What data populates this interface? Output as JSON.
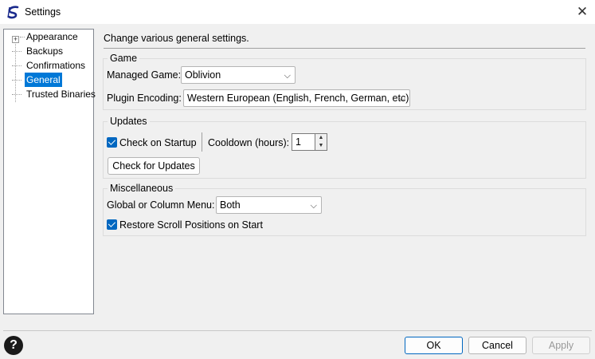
{
  "window": {
    "title": "Settings"
  },
  "tree": {
    "items": [
      {
        "label": "Appearance"
      },
      {
        "label": "Backups"
      },
      {
        "label": "Confirmations"
      },
      {
        "label": "General"
      },
      {
        "label": "Trusted Binaries"
      }
    ]
  },
  "general": {
    "description": "Change various general settings.",
    "game": {
      "title": "Game",
      "managed_game_label": "Managed Game:",
      "managed_game_value": "Oblivion",
      "plugin_encoding_label": "Plugin Encoding:",
      "plugin_encoding_value": "Western European (English, French, German, etc)"
    },
    "updates": {
      "title": "Updates",
      "check_on_startup_label": "Check on Startup",
      "check_on_startup_checked": true,
      "cooldown_label": "Cooldown (hours):",
      "cooldown_value": "1",
      "check_button": "Check for Updates"
    },
    "misc": {
      "title": "Miscellaneous",
      "menu_label": "Global or Column Menu:",
      "menu_value": "Both",
      "restore_scroll_label": "Restore Scroll Positions on Start",
      "restore_scroll_checked": true
    }
  },
  "footer": {
    "help": "?",
    "ok": "OK",
    "cancel": "Cancel",
    "apply": "Apply"
  },
  "colors": {
    "accent": "#0067c0",
    "selection": "#0078d7"
  }
}
